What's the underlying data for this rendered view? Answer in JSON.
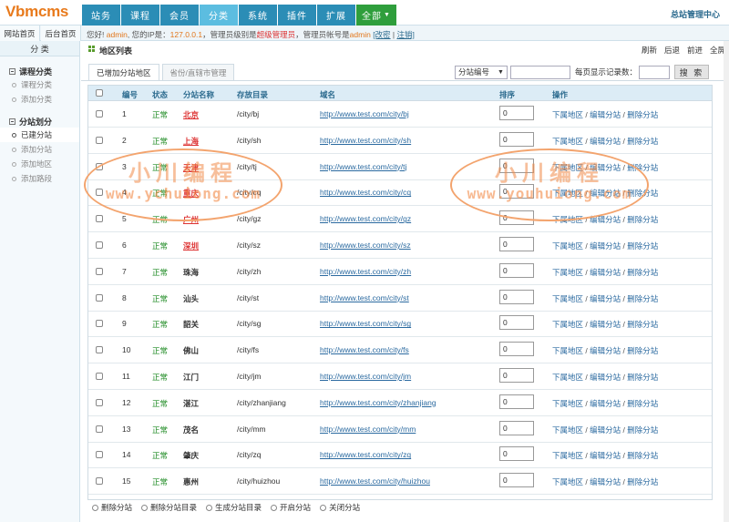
{
  "app": {
    "logo": "Vbmcms",
    "center_link": "总站管理中心"
  },
  "nav": [
    {
      "label": "站务",
      "state": ""
    },
    {
      "label": "课程",
      "state": ""
    },
    {
      "label": "会员",
      "state": ""
    },
    {
      "label": "分类",
      "state": "active"
    },
    {
      "label": "系统",
      "state": ""
    },
    {
      "label": "插件",
      "state": ""
    },
    {
      "label": "扩展",
      "state": ""
    },
    {
      "label": "全部",
      "state": "all"
    }
  ],
  "home_tabs": [
    "网站首页",
    "后台首页"
  ],
  "welcome": {
    "prefix": "您好! ",
    "user": "admin",
    "ip_label": ", 您的IP是：",
    "ip": "127.0.0.1",
    "level_label": "，管理员级别是",
    "level": "超级管理员",
    "account_label": "，管理员帐号是",
    "account": "admin",
    "change": "[改密",
    "sep": " | ",
    "logout": "注销]"
  },
  "sidebar": {
    "title": "分 类",
    "groups": [
      {
        "title": "课程分类",
        "items": [
          {
            "label": "课程分类",
            "active": false
          },
          {
            "label": "添加分类",
            "active": false
          }
        ]
      },
      {
        "title": "分站划分",
        "items": [
          {
            "label": "已建分站",
            "active": true
          },
          {
            "label": "添加分站",
            "active": false
          },
          {
            "label": "添加地区",
            "active": false
          },
          {
            "label": "添加路段",
            "active": false
          }
        ]
      }
    ]
  },
  "main": {
    "title": "地区列表",
    "actions": [
      "刷新",
      "后退",
      "前进",
      "全屏"
    ],
    "tabs": [
      {
        "label": "已增加分站地区",
        "active": true
      },
      {
        "label": "省份/直辖市管理",
        "active": false
      }
    ],
    "search": {
      "select_value": "分站编号",
      "per_page_label": "每页显示记录数：",
      "button": "搜 索"
    }
  },
  "table": {
    "columns": [
      "编号",
      "状态",
      "分站名称",
      "存放目录",
      "域名",
      "排序",
      "操作"
    ],
    "rows": [
      {
        "id": "1",
        "status": "正常",
        "name": "北京",
        "dir": "/city/bj",
        "url": "http://www.test.com/city/bj",
        "sort": "0",
        "highlight": true
      },
      {
        "id": "2",
        "status": "正常",
        "name": "上海",
        "dir": "/city/sh",
        "url": "http://www.test.com/city/sh",
        "sort": "0",
        "highlight": true
      },
      {
        "id": "3",
        "status": "正常",
        "name": "天津",
        "dir": "/city/tj",
        "url": "http://www.test.com/city/tj",
        "sort": "0",
        "highlight": true
      },
      {
        "id": "4",
        "status": "正常",
        "name": "重庆",
        "dir": "/city/cq",
        "url": "http://www.test.com/city/cq",
        "sort": "0",
        "highlight": true
      },
      {
        "id": "5",
        "status": "正常",
        "name": "广州",
        "dir": "/city/gz",
        "url": "http://www.test.com/city/gz",
        "sort": "0",
        "highlight": true
      },
      {
        "id": "6",
        "status": "正常",
        "name": "深圳",
        "dir": "/city/sz",
        "url": "http://www.test.com/city/sz",
        "sort": "0",
        "highlight": true
      },
      {
        "id": "7",
        "status": "正常",
        "name": "珠海",
        "dir": "/city/zh",
        "url": "http://www.test.com/city/zh",
        "sort": "0",
        "highlight": false
      },
      {
        "id": "8",
        "status": "正常",
        "name": "汕头",
        "dir": "/city/st",
        "url": "http://www.test.com/city/st",
        "sort": "0",
        "highlight": false
      },
      {
        "id": "9",
        "status": "正常",
        "name": "韶关",
        "dir": "/city/sg",
        "url": "http://www.test.com/city/sg",
        "sort": "0",
        "highlight": false
      },
      {
        "id": "10",
        "status": "正常",
        "name": "佛山",
        "dir": "/city/fs",
        "url": "http://www.test.com/city/fs",
        "sort": "0",
        "highlight": false
      },
      {
        "id": "11",
        "status": "正常",
        "name": "江门",
        "dir": "/city/jm",
        "url": "http://www.test.com/city/jm",
        "sort": "0",
        "highlight": false
      },
      {
        "id": "12",
        "status": "正常",
        "name": "湛江",
        "dir": "/city/zhanjiang",
        "url": "http://www.test.com/city/zhanjiang",
        "sort": "0",
        "highlight": false
      },
      {
        "id": "13",
        "status": "正常",
        "name": "茂名",
        "dir": "/city/mm",
        "url": "http://www.test.com/city/mm",
        "sort": "0",
        "highlight": false
      },
      {
        "id": "14",
        "status": "正常",
        "name": "肇庆",
        "dir": "/city/zq",
        "url": "http://www.test.com/city/zq",
        "sort": "0",
        "highlight": false
      },
      {
        "id": "15",
        "status": "正常",
        "name": "惠州",
        "dir": "/city/huizhou",
        "url": "http://www.test.com/city/huizhou",
        "sort": "0",
        "highlight": false
      }
    ],
    "ops": [
      "下属地区",
      "编辑分站",
      "删除分站"
    ],
    "ops_sep": " / "
  },
  "bottom_actions": [
    "删除分站",
    "删除分站目录",
    "生成分站目录",
    "开启分站",
    "关闭分站"
  ],
  "watermark": {
    "cn": "小川编程",
    "left_en": "www.ychuiong.com",
    "right_en": "www.youhuiong.com"
  }
}
